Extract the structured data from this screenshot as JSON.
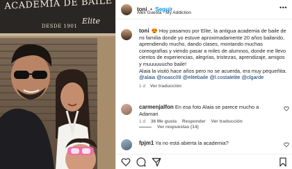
{
  "photo": {
    "sign_line1": "ACADEMIA DE BAILE",
    "sign_line2": "DESDE 1901",
    "sign_signature": "Elite"
  },
  "header": {
    "username": "toni",
    "separator": "•",
    "follow_label": "Seguir",
    "subtitle": "Alex Guesta · My Addiction"
  },
  "caption": {
    "username": "toni",
    "text_main": "😍 Hoy pasamos por Elite, la antigua academia de baile de mi familia donde yo estuve aproximadamente 20 años bailando, aprendiendo mucho, dando clases, montando muchas coreografías y viendo pasar a miles de alumnos, donde me llevo cientos de experiencias, alegrías, tristezas, aprendizaje, amigos y muuuuuucho baile!",
    "text_second": "Alaia la visitó hace años pero no se acuerda, era muy pequeñita. ",
    "mentions": [
      "@alaia",
      "@noasc09",
      "@elitebaile",
      "@l.costalelite",
      "@clgarde"
    ],
    "time": "1 d",
    "translate_label": "Ver traducción"
  },
  "comments": [
    {
      "username": "carmenjalfon",
      "text": "En esa foto Alaia se parece mucho a Adamari",
      "time": "1 d",
      "likes": "36 Me gusta",
      "reply_label": "Responder",
      "translate_label": "Ver traducción",
      "replies_label": "Ver respuestas (14)"
    },
    {
      "username": "fpjm1",
      "text": "Ya no está abierta la academia?"
    }
  ],
  "icons": {
    "more": "more-horizontal-icon",
    "like": "heart-icon",
    "comment": "comment-icon",
    "share": "paper-plane-icon",
    "save": "bookmark-icon"
  },
  "colors": {
    "accent": "#0095f6",
    "mention": "#00376b",
    "muted": "#737373",
    "border": "#efefef"
  }
}
